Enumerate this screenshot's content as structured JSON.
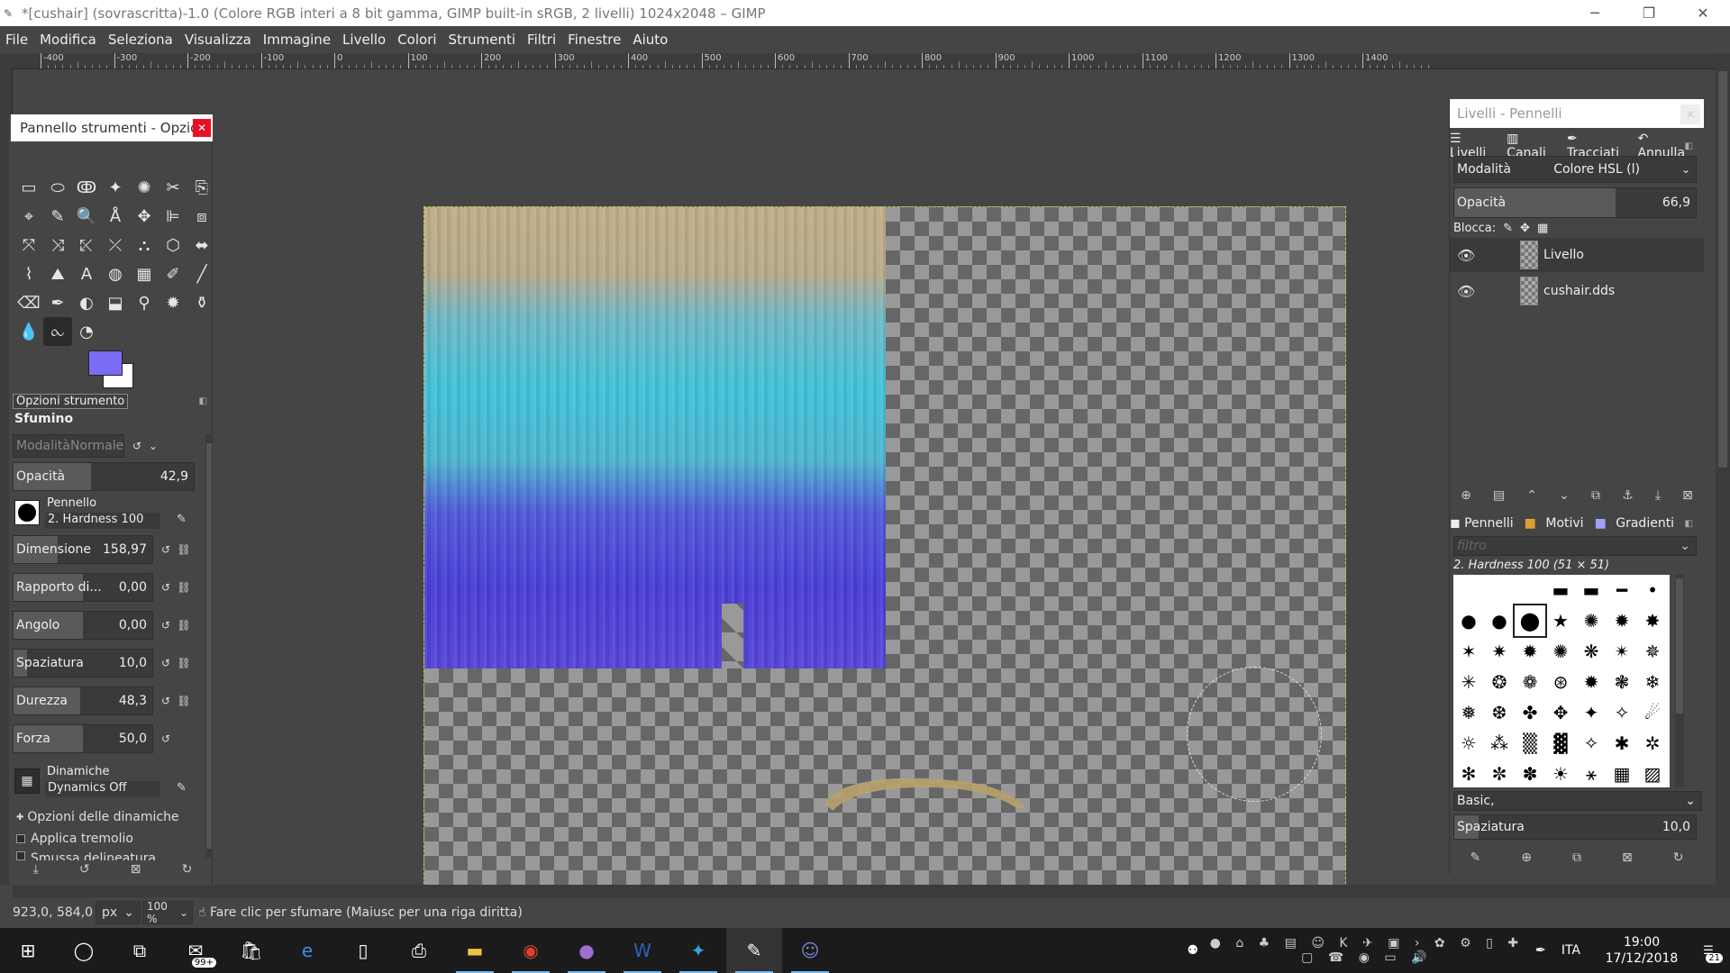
{
  "window": {
    "title": "*[cushair] (sovrascritta)-1.0 (Colore RGB interi a 8 bit gamma, GIMP built-in sRGB, 2 livelli) 1024x2048 – GIMP",
    "minimize": "─",
    "maximize": "❐",
    "close": "✕"
  },
  "menu": [
    "File",
    "Modifica",
    "Seleziona",
    "Visualizza",
    "Immagine",
    "Livello",
    "Colori",
    "Strumenti",
    "Filtri",
    "Finestre",
    "Aiuto"
  ],
  "ruler_labels": [
    "-400",
    "-300",
    "-200",
    "-100",
    "0",
    "100",
    "200",
    "300",
    "400",
    "500",
    "600",
    "700",
    "800",
    "900",
    "1000",
    "1100",
    "1200",
    "1300",
    "1400"
  ],
  "toolbox": {
    "title": "Pannello strumenti - Opzio...",
    "close": "✕",
    "tools": [
      "▭",
      "⬭",
      "ↂ",
      "✦",
      "✺",
      "✂",
      "⎘",
      "⌖",
      "✎",
      "🔍",
      "Å",
      "✥",
      "⊫",
      "⧈",
      "⤧",
      "⤨",
      "⤪",
      "⤫",
      "⛬",
      "⬡",
      "⬌",
      "⌇",
      "⛰",
      "A",
      "◍",
      "▦",
      "✐",
      "╱",
      "⌫",
      "✒",
      "◐",
      "⬓",
      "⚲",
      "✹",
      "⚱",
      "💧",
      "⧜",
      "◔"
    ],
    "active_tool_index": 36,
    "fg_color": "#7b6cf5",
    "bg_color": "#ffffff",
    "options_tab": "Opzioni strumento",
    "tool_name": "Sfumino",
    "mode_label": "Modalità",
    "mode_value": "Normale",
    "opacity": {
      "label": "Opacità",
      "value": "42,9",
      "fraction": 0.429
    },
    "brush": {
      "label": "Pennello",
      "value": "2. Hardness 100"
    },
    "size": {
      "label": "Dimensione",
      "value": "158,97",
      "fraction": 0.32
    },
    "ratio": {
      "label": "Rapporto di...",
      "value": "0,00",
      "fraction": 0.5
    },
    "angle": {
      "label": "Angolo",
      "value": "0,00",
      "fraction": 0.5
    },
    "spacing": {
      "label": "Spaziatura",
      "value": "10,0",
      "fraction": 0.1
    },
    "hardness": {
      "label": "Durezza",
      "value": "48,3",
      "fraction": 0.483
    },
    "force": {
      "label": "Forza",
      "value": "50,0",
      "fraction": 0.5
    },
    "dynamics": {
      "label": "Dinamiche",
      "value": "Dynamics Off"
    },
    "dyn_options": "Opzioni delle dinamiche",
    "jitter": "Applica tremolio",
    "smooth": "Smussa delineatura"
  },
  "status": {
    "coords": "923,0, 584,0",
    "unit": "px",
    "zoom": "100 %",
    "message": "Fare clic per sfumare (Maiusc per una riga diritta)"
  },
  "layers_dock": {
    "title": "Livelli - Pennelli",
    "tabs": [
      "Livelli",
      "Canali",
      "Tracciati",
      "Annulla"
    ],
    "mode_label": "Modalità",
    "mode_value": "Colore HSL (l)",
    "opacity": {
      "label": "Opacità",
      "value": "66,9",
      "fraction": 0.669
    },
    "lock_label": "Blocca:",
    "layers": [
      {
        "name": "Livello",
        "selected": true
      },
      {
        "name": "cushair.dds",
        "selected": false
      }
    ]
  },
  "brushes_dock": {
    "tabs": [
      "Pennelli",
      "Motivi",
      "Gradienti"
    ],
    "filter_placeholder": "filtro",
    "selected_brush": "2. Hardness 100 (51 × 51)",
    "tag": "Basic,",
    "spacing": {
      "label": "Spaziatura",
      "value": "10,0",
      "fraction": 0.1
    }
  },
  "taskbar": {
    "badge": "99+",
    "lang": "ITA",
    "time": "19:00",
    "date": "17/12/2018",
    "notifications": "21"
  }
}
